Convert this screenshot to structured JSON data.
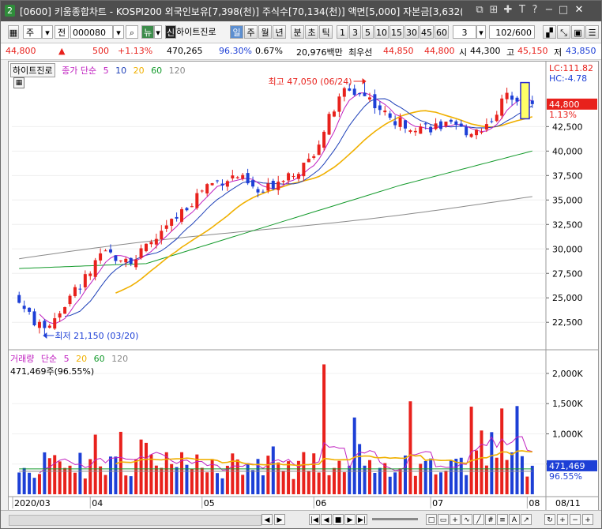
{
  "window": {
    "title": "[0600] 키움종합차트 - KOSPI200 외국인보유[7,398(천)] 주식수[70,134(천)] 액면[5,000] 자본금[3,632(",
    "icon_label": "2"
  },
  "toolbar": {
    "type1": "주",
    "type2": "전",
    "code": "000080",
    "stock_name": "하이트진로",
    "periods": [
      "일",
      "주",
      "월",
      "년",
      "분",
      "초",
      "틱"
    ],
    "active_period": "일",
    "intervals": [
      "1",
      "3",
      "5",
      "10",
      "15",
      "30",
      "45",
      "60"
    ],
    "interval_value": "3",
    "count": "102/600",
    "badge": "신"
  },
  "quote": {
    "price": "44,800",
    "arrow": "▲",
    "change": "500",
    "change_pct": "+1.13%",
    "volume": "470,265",
    "volume_ratio": "96.30%",
    "turnover": "0.67%",
    "amount": "20,976백만",
    "label_best_ask": "최우선",
    "best_ask": "44,850",
    "best_bid": "44,800",
    "label_open": "시",
    "open": "44,300",
    "label_high": "고",
    "high": "45,150",
    "label_low": "저",
    "low": "43,850"
  },
  "price_panel": {
    "legend_name": "하이트진로",
    "legend_ma": "종가 단순",
    "ma_periods": [
      "5",
      "10",
      "20",
      "60",
      "120"
    ],
    "lc": "LC:111.82",
    "hc": "HC:-4.78",
    "current_price": "44,800",
    "current_pct": "1.13%",
    "y_ticks": [
      "42,500",
      "40,000",
      "37,500",
      "35,000",
      "32,500",
      "30,000",
      "27,500",
      "25,000",
      "22,500"
    ],
    "high_annot": "최고 47,050 (06/24)",
    "low_annot": "최저 21,150 (03/20)"
  },
  "volume_panel": {
    "legend_name": "거래량",
    "legend_ma": "단순",
    "ma_periods": [
      "5",
      "20",
      "60",
      "120"
    ],
    "volume_text": "471,469주(96.55%)",
    "y_ticks": [
      "2,000K",
      "1,500K",
      "1,000K",
      "500K"
    ],
    "current_volume": "471,469",
    "current_pct": "96.55%"
  },
  "x_labels": [
    "2020/03",
    "04",
    "05",
    "06",
    "07",
    "08",
    "08/11"
  ],
  "colors": {
    "up": "#e8211c",
    "down": "#1d3fd6",
    "ma5": "#c020c0",
    "ma10": "#1d3fb8",
    "ma20": "#f0b000",
    "ma60": "#139a2b",
    "ma120": "#8a8a8a"
  },
  "chart_data": {
    "type": "candlestick",
    "title": "하이트진로",
    "xlabel": "",
    "ylabel": "",
    "ylim": [
      20500,
      48500
    ],
    "volume_ylim": [
      0,
      2300000
    ],
    "x": [
      "2020/03",
      "04",
      "05",
      "06",
      "07",
      "08",
      "08/11"
    ],
    "close_start": 24500,
    "high_point": {
      "value": 47050,
      "date": "06/24"
    },
    "low_point": {
      "value": 21150,
      "date": "03/20"
    },
    "last_close": 44800,
    "last_volume": 471469
  }
}
